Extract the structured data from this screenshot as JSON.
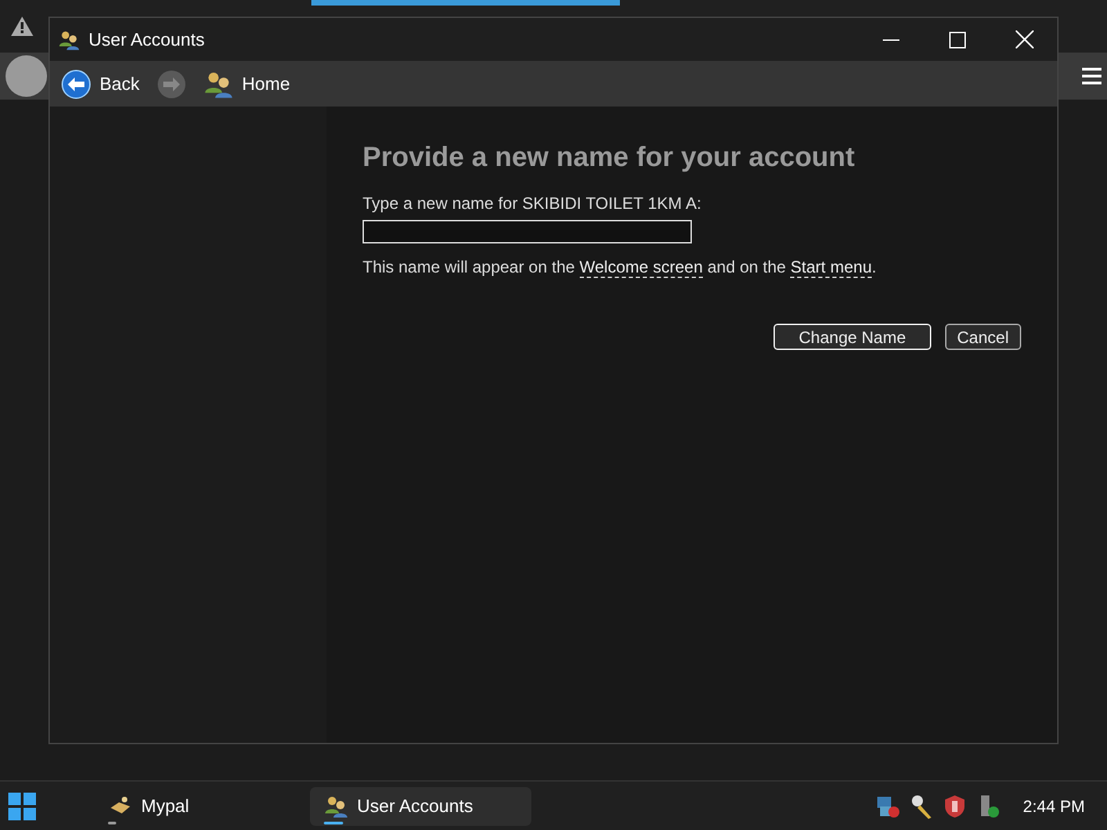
{
  "window": {
    "title": "User Accounts"
  },
  "nav": {
    "back": {
      "label": "Back",
      "disabled": false
    },
    "forward": {
      "disabled": true
    },
    "home": {
      "label": "Home"
    }
  },
  "content": {
    "heading": "Provide a new name for your account",
    "prompt": "Type a new name for SKIBIDI TOILET 1KM A:",
    "note": [
      {
        "kind": "text",
        "text": "This name will appear on the "
      },
      {
        "kind": "link",
        "text": "Welcome screen"
      },
      {
        "kind": "text",
        "text": " and on the "
      },
      {
        "kind": "link",
        "text": "Start menu"
      },
      {
        "kind": "text",
        "text": "."
      }
    ],
    "buttons": [
      {
        "label": "Change Name",
        "default": true
      },
      {
        "label": "Cancel",
        "default": false
      }
    ]
  },
  "taskbar": {
    "items": [
      {
        "label": "Mypal",
        "selected": false
      },
      {
        "label": "User Accounts",
        "selected": true
      }
    ],
    "clock": "2:44 PM"
  }
}
